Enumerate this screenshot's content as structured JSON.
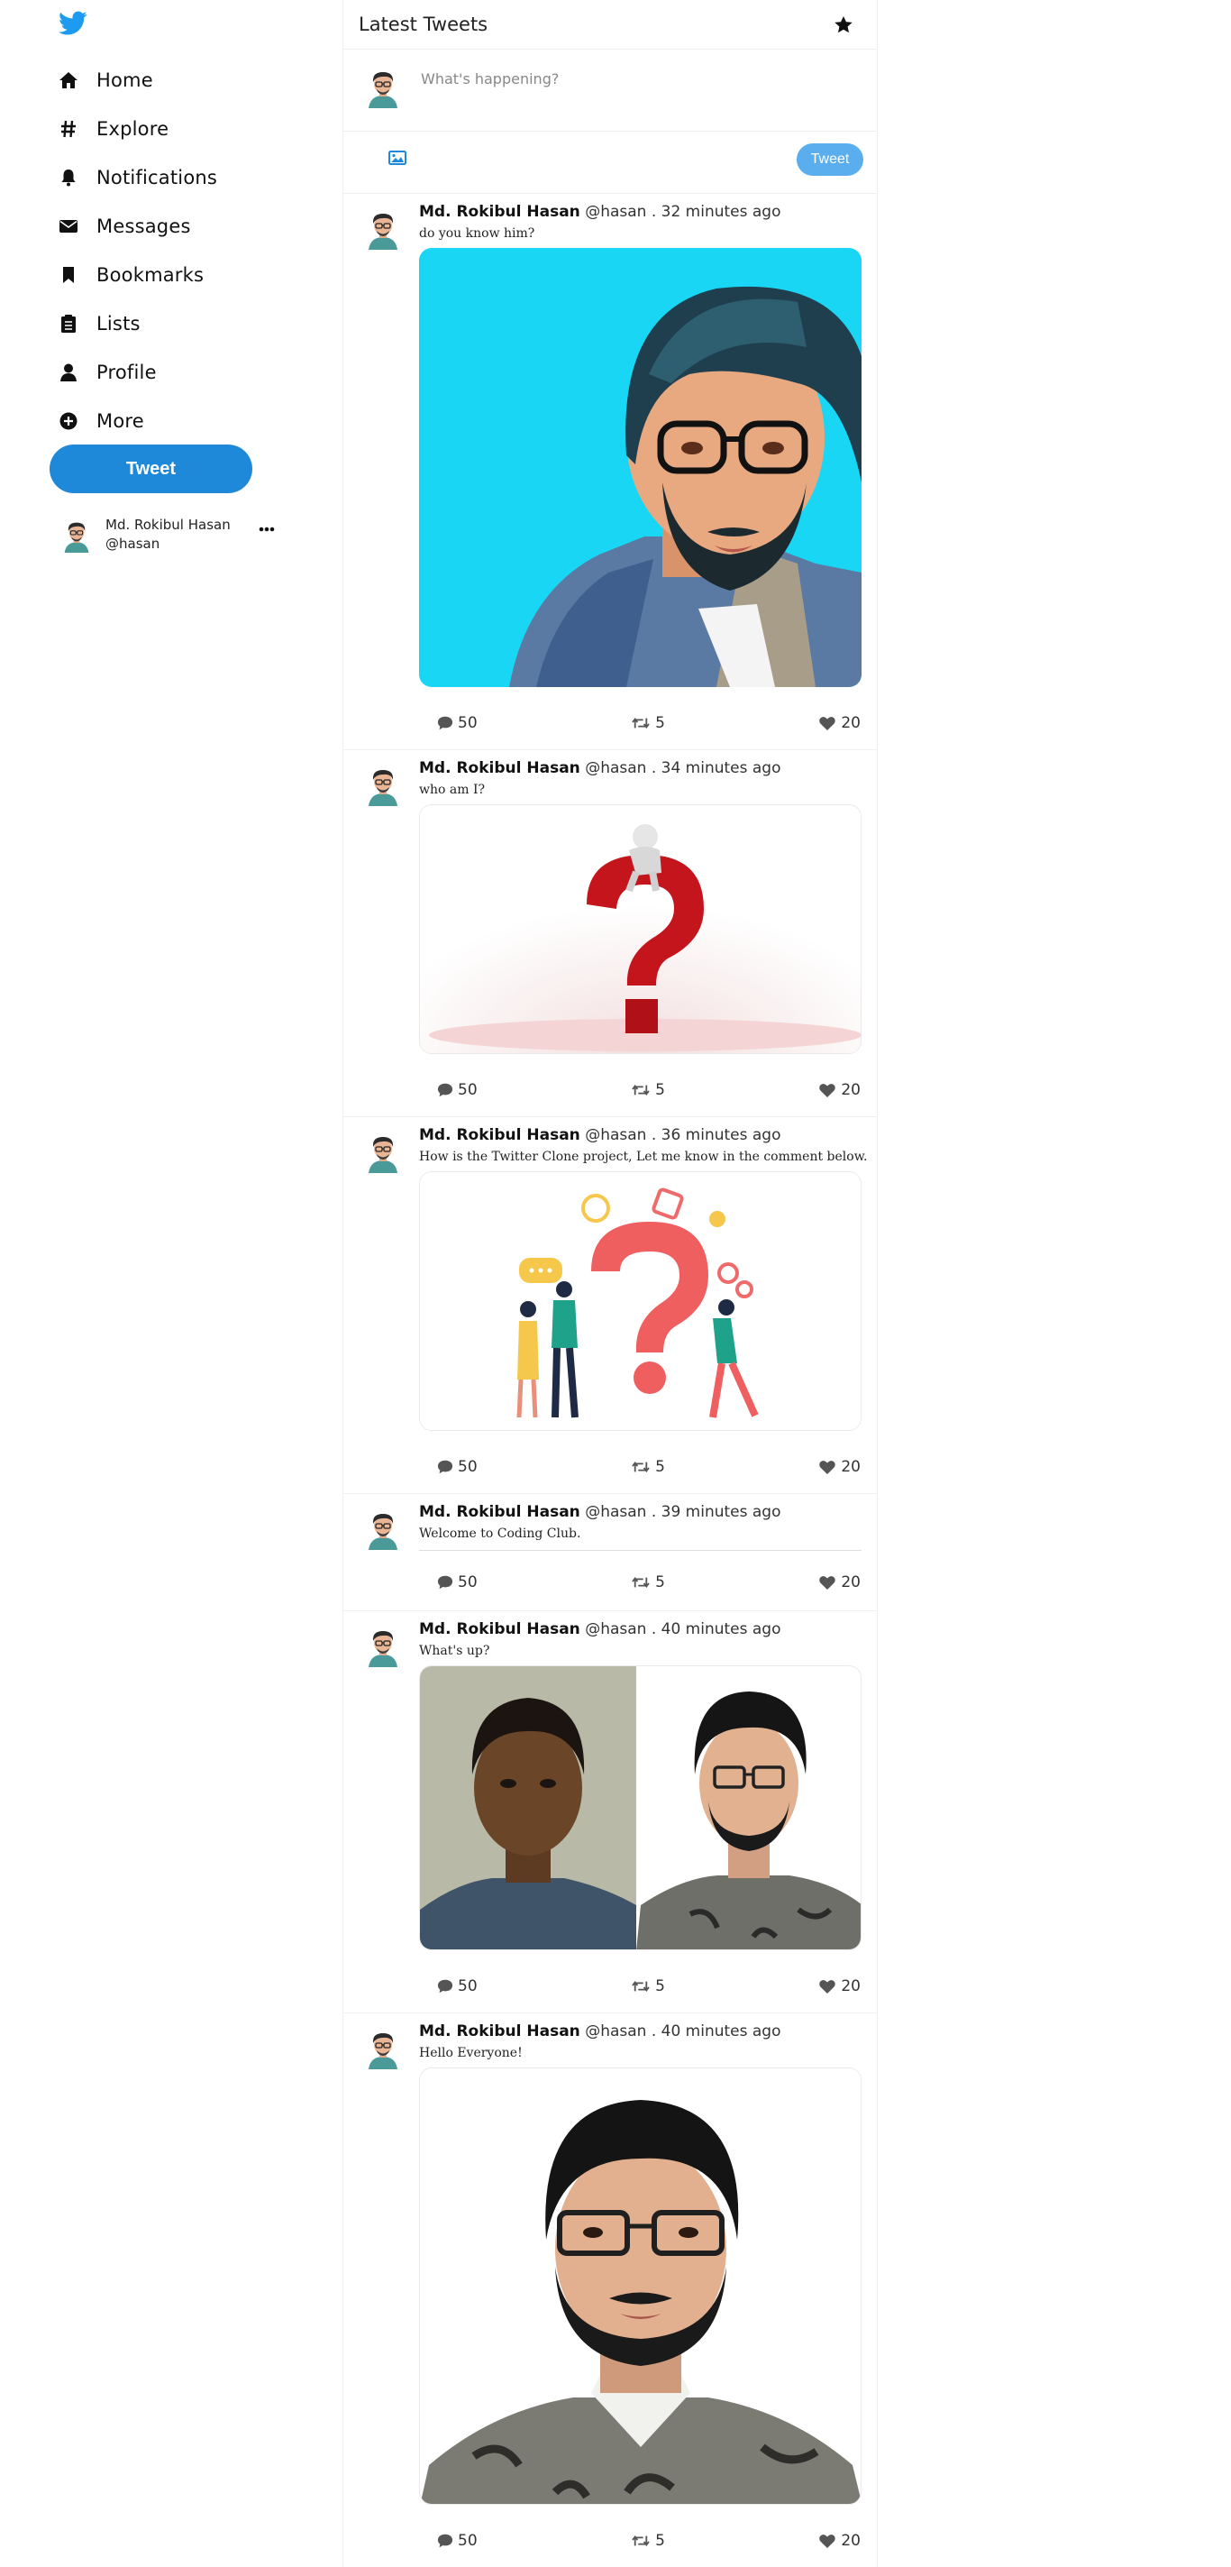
{
  "sidebar": {
    "nav": [
      {
        "label": "Home",
        "icon": "home-icon"
      },
      {
        "label": "Explore",
        "icon": "hashtag-icon"
      },
      {
        "label": "Notifications",
        "icon": "bell-icon"
      },
      {
        "label": "Messages",
        "icon": "envelope-icon"
      },
      {
        "label": "Bookmarks",
        "icon": "bookmark-icon"
      },
      {
        "label": "Lists",
        "icon": "list-icon"
      },
      {
        "label": "Profile",
        "icon": "user-icon"
      },
      {
        "label": "More",
        "icon": "plus-circle-icon"
      }
    ],
    "tweet_button": "Tweet",
    "profile": {
      "name": "Md. Rokibul Hasan",
      "handle": "@hasan"
    }
  },
  "feed": {
    "title": "Latest Tweets",
    "composer": {
      "placeholder": "What's happening?",
      "button": "Tweet"
    },
    "tweets": [
      {
        "name": "Md. Rokibul Hasan",
        "meta": "@hasan . 32 minutes ago",
        "text": "do you know him?",
        "comments": "50",
        "retweets": "5",
        "likes": "20"
      },
      {
        "name": "Md. Rokibul Hasan",
        "meta": "@hasan . 34 minutes ago",
        "text": "who am I?",
        "comments": "50",
        "retweets": "5",
        "likes": "20"
      },
      {
        "name": "Md. Rokibul Hasan",
        "meta": "@hasan . 36 minutes ago",
        "text": "How is the Twitter Clone project, Let me know in the comment below.",
        "comments": "50",
        "retweets": "5",
        "likes": "20"
      },
      {
        "name": "Md. Rokibul Hasan",
        "meta": "@hasan . 39 minutes ago",
        "text": "Welcome to Coding Club.",
        "comments": "50",
        "retweets": "5",
        "likes": "20"
      },
      {
        "name": "Md. Rokibul Hasan",
        "meta": "@hasan . 40 minutes ago",
        "text": "What's up?",
        "comments": "50",
        "retweets": "5",
        "likes": "20"
      },
      {
        "name": "Md. Rokibul Hasan",
        "meta": "@hasan . 40 minutes ago",
        "text": "Hello Everyone!",
        "comments": "50",
        "retweets": "5",
        "likes": "20"
      }
    ]
  },
  "colors": {
    "brand": "#1d9bf0",
    "button": "#1d89d8",
    "button_light": "#5aaeee"
  }
}
